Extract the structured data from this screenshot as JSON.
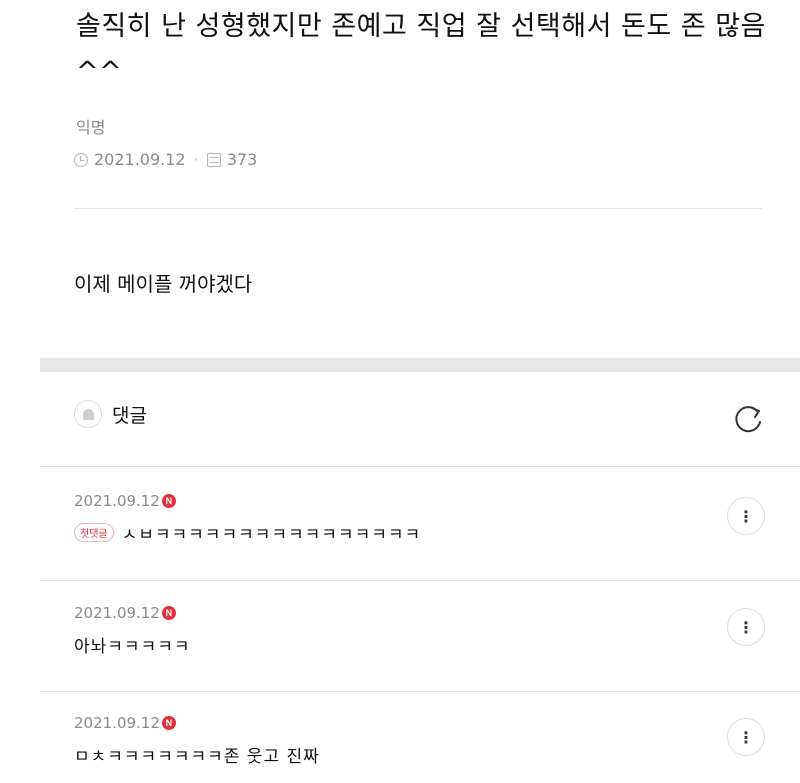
{
  "post": {
    "title": "솔직히 난 성형했지만 존예고 직업 잘 선택해서 돈도 존 많음 ^^",
    "author": "익명",
    "date": "2021.09.12",
    "views": "373",
    "separator": "·",
    "body": "이제 메이플 꺼야겠다"
  },
  "comments_section": {
    "title": "댓글",
    "bell_icon": "bell-icon",
    "refresh_icon": "refresh-icon"
  },
  "comments": [
    {
      "date": "2021.09.12",
      "badge": "N",
      "first_label": "첫댓글",
      "text": "ㅅㅂㅋㅋㅋㅋㅋㅋㅋㅋㅋㅋㅋㅋㅋㅋㅋㅋ"
    },
    {
      "date": "2021.09.12",
      "badge": "N",
      "text": "아놔ㅋㅋㅋㅋㅋ"
    },
    {
      "date": "2021.09.12",
      "badge": "N",
      "text": "ㅁㅊㅋㅋㅋㅋㅋㅋㅋ존 웃고 진짜"
    }
  ],
  "more_label": "⋮",
  "colors": {
    "accent_red": "#e2313a",
    "muted_text": "#8a8a8a",
    "band": "#e7e7e9"
  }
}
